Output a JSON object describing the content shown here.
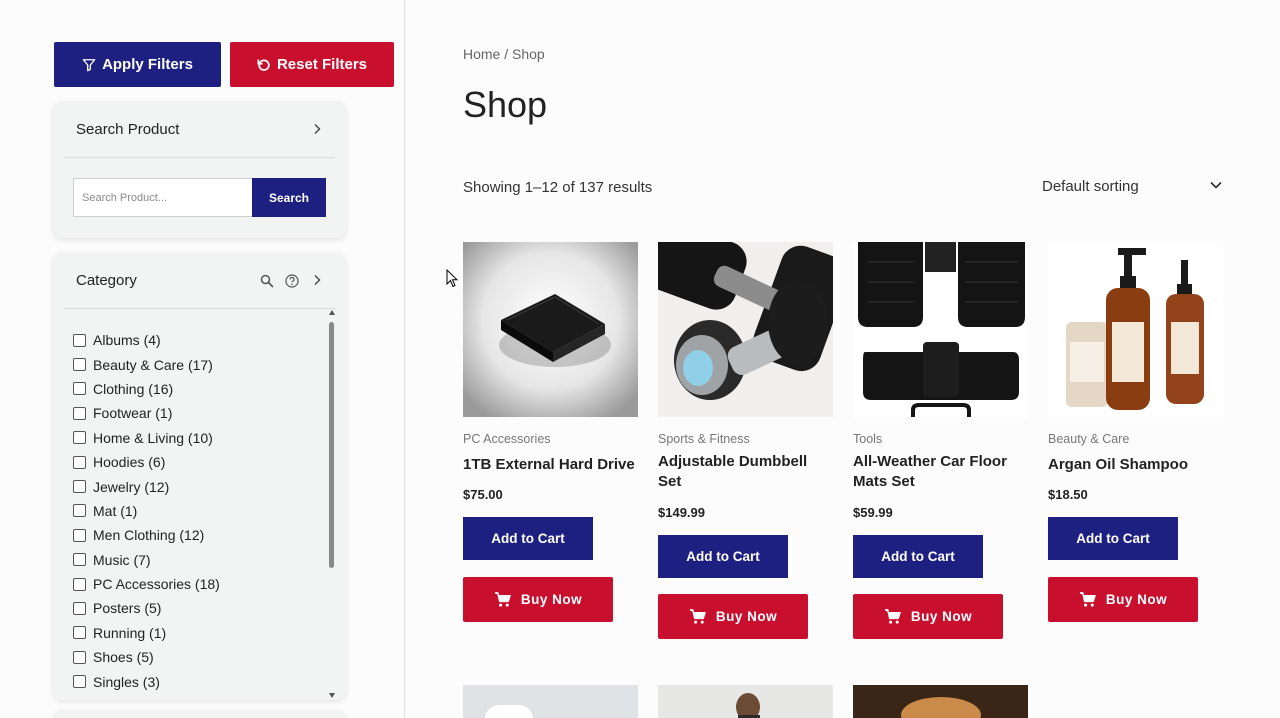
{
  "filters": {
    "apply_label": "Apply Filters",
    "reset_label": "Reset Filters"
  },
  "search_panel": {
    "title": "Search Product",
    "placeholder": "Search Product...",
    "button_label": "Search"
  },
  "category_panel": {
    "title": "Category",
    "items": [
      "Albums (4)",
      "Beauty & Care (17)",
      "Clothing (16)",
      "Footwear (1)",
      "Home & Living (10)",
      "Hoodies (6)",
      "Jewelry (12)",
      "Mat (1)",
      "Men Clothing (12)",
      "Music (7)",
      "PC Accessories (18)",
      "Posters (5)",
      "Running (1)",
      "Shoes (5)",
      "Singles (3)"
    ]
  },
  "breadcrumb": "Home / Shop",
  "page_title": "Shop",
  "result_count": "Showing 1–12 of 137 results",
  "sorting": {
    "selected": "Default sorting"
  },
  "products": [
    {
      "category": "PC Accessories",
      "name": "1TB External Hard Drive",
      "price": "$75.00",
      "add_label": "Add to Cart",
      "buy_label": "Buy Now"
    },
    {
      "category": "Sports & Fitness",
      "name": "Adjustable Dumbbell Set",
      "price": "$149.99",
      "add_label": "Add to Cart",
      "buy_label": "Buy Now"
    },
    {
      "category": "Tools",
      "name": "All-Weather Car Floor Mats Set",
      "price": "$59.99",
      "add_label": "Add to Cart",
      "buy_label": "Buy Now"
    },
    {
      "category": "Beauty & Care",
      "name": "Argan Oil Shampoo",
      "price": "$18.50",
      "add_label": "Add to Cart",
      "buy_label": "Buy Now"
    }
  ],
  "colors": {
    "primary": "#1d2080",
    "accent": "#c8102e"
  }
}
